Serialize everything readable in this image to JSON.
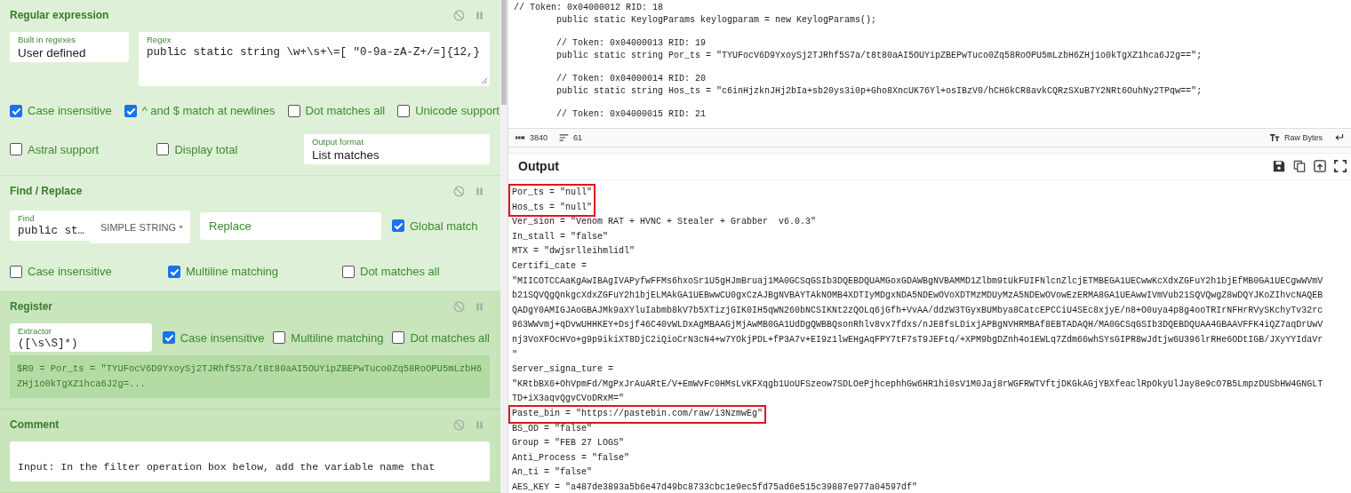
{
  "regex_op": {
    "title": "Regular expression",
    "builtin": {
      "label": "Built in regexes",
      "value": "User defined"
    },
    "regex": {
      "label": "Regex",
      "value": "public static string \\w+\\s+\\=[ \"0-9a-zA-Z+/=]{12,}"
    },
    "options": [
      {
        "label": "Case insensitive",
        "checked": true
      },
      {
        "label": "^ and $ match at newlines",
        "checked": true
      },
      {
        "label": "Dot matches all",
        "checked": false
      },
      {
        "label": "Unicode support",
        "checked": false
      },
      {
        "label": "Astral support",
        "checked": false
      },
      {
        "label": "Display total",
        "checked": false
      }
    ],
    "output_format": {
      "label": "Output format",
      "value": "List matches"
    }
  },
  "find_replace_op": {
    "title": "Find / Replace",
    "find": {
      "label": "Find",
      "value": "public st…"
    },
    "find_type": "SIMPLE STRING",
    "replace": {
      "placeholder": "Replace"
    },
    "global_match": {
      "label": "Global match",
      "checked": true
    },
    "options": [
      {
        "label": "Case insensitive",
        "checked": false
      },
      {
        "label": "Multiline matching",
        "checked": true
      },
      {
        "label": "Dot matches all",
        "checked": false
      }
    ]
  },
  "register_op": {
    "title": "Register",
    "extractor": {
      "label": "Extractor",
      "value": "([\\s\\S]*)"
    },
    "options": [
      {
        "label": "Case insensitive",
        "checked": true
      },
      {
        "label": "Multiline matching",
        "checked": false
      },
      {
        "label": "Dot matches all",
        "checked": false
      }
    ],
    "result": "$R0 = Por_ts = \"TYUFocV6D9YxoySj2TJRhf5S7a/t8t80aAI5OUYipZBEPwTuco0Zq58RoOPU5mLzbH6ZHj1o0kTgXZ1hca6J2g=..."
  },
  "comment_op": {
    "title": "Comment",
    "text": "Input: In the filter operation box below, add the variable name that"
  },
  "input": {
    "blocks": [
      [
        "// Token: 0x04000012 RID: 18",
        "        public static KeylogParams keylogparam = new KeylogParams();"
      ],
      [
        "        // Token: 0x04000013 RID: 19",
        "        public static string Por_ts = \"TYUFocV6D9YxoySj2TJRhf5S7a/t8t80aAI5OUYipZBEPwTuco0Zq58RoOPU5mLzbH6ZHj1o0kTgXZ1hca6J2g==\";"
      ],
      [
        "        // Token: 0x04000014 RID: 20",
        "        public static string Hos_ts = \"c6inHjzknJHj2bIa+sb20ys3i0p+Gho8XncUK76Yl+osIBzV0/hCH6kCR8avkCQRzSXuB7Y2NRt6OuhNy2TPqw==\";"
      ],
      [
        "        // Token: 0x04000015 RID: 21"
      ]
    ],
    "length": "3840",
    "line_count": "61",
    "encoding": "Raw Bytes"
  },
  "output": {
    "title": "Output",
    "blocks": [
      {
        "highlighted": true,
        "lines": [
          "Por_ts = \"null\"",
          "Hos_ts = \"null\""
        ]
      },
      {
        "highlighted": false,
        "lines": [
          "Ver_sion = \"Venom RAT + HVNC + Stealer + Grabber  v6.0.3\"",
          "In_stall = \"false\"",
          "MTX = \"dwjsrlleihmlidl\"",
          "Certifi_cate =",
          "\"MIICOTCCAaKgAwIBAgIVAPyfwFFMs6hxoSr1U5gHJmBruaj1MA0GCSqGSIb3DQEBDQUAMGoxGDAWBgNVBAMMD1Zlbm9tUkFUIFNlcnZlcjETMBEGA1UECwwKcXdxZGFuY2h1bjEfMB0GA1UECgwWVmV",
          "b21SQVQgQnkgcXdxZGFuY2h1bjELMAkGA1UEBwwCU0gxCzAJBgNVBAYTAkNOMB4XDTIyMDgxNDA5NDEwOVoXDTMzMDUyMzA5NDEwOVowEzERMA8GA1UEAwwIVmVub21SQVQwgZ8wDQYJKoZIhvcNAQEB",
          "QADgY0AMIGJAoGBAJMk9aXYluIabmb8kV7b5XTizjGIK0IH5qWN260bNCSIKNt2zQOLq6jGfh+VvAA/ddzW3TGyxBUMbya8CatcEPCCiU4SEc8xjyE/n8+O0uya4p8g4ooTRIrNFHrRVySKchyTv32rc",
          "963WWvmj+qDvwUHHKEY+Dsjf46C40vWLDxAgMBAAGjMjAwMB0GA1UdDgQWBBQsonRhlv8vx7fdxs/nJE8fsLDixjAPBgNVHRMBAf8EBTADAQH/MA0GCSqGSIb3DQEBDQUAA4GBAAVFFK4iQZ7aqDrUwV",
          "nj3VoXFOcHVo+g9p9ikiXT8DjC2iQioCrN3cN4+w7YOkjPDL+fP3A7v+EI9z1lwEHgAqFPY7tF7sT9JEFtq/+XPM9bgDZnh4o1EWLq7Zdm66whSYsGIPR8wJdtjw6U396lrRHe6ODtIGB/JXyYYIdaVr",
          "\"",
          "Server_signa_ture =",
          "\"KRtbBX6+OhVpmFd/MgPxJrAuARtE/V+EmWvFc0HMsLvKFXqgb1UoUFSzeow7SDLOePjhcephhGw6HR1hi0sV1M0Jaj8rWGFRWTVftjDKGkAGjYBXfeaclRpOkyUlJay8e9cO7B5LmpzDUSbHW4GNGLT",
          "TD+iX3aqvQgvCVoDRxM=\""
        ]
      },
      {
        "highlighted": true,
        "lines": [
          "Paste_bin = \"https://pastebin.com/raw/i3NzmwEg\""
        ]
      },
      {
        "highlighted": false,
        "lines": [
          "BS_OD = \"false\"",
          "Group = \"FEB 27 LOGS\"",
          "Anti_Process = \"false\"",
          "An_ti = \"false\"",
          "AES_KEY = \"a487de3893a5b6e47d49bc8733cbc1e9ec5fd75ad6e515c39887e977a04597df\""
        ]
      }
    ]
  }
}
